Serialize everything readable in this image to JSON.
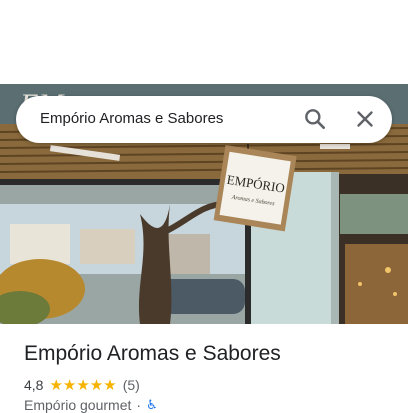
{
  "search": {
    "query": "Empório Aromas e Sabores",
    "search_icon": "search-icon",
    "close_icon": "close-icon"
  },
  "photo": {
    "sign_line1": "EMPÓRIO",
    "sign_line2": "Aromas e Sabores",
    "awning_text": "EM"
  },
  "place": {
    "name": "Empório Aromas e Sabores",
    "rating": "4,8",
    "stars": "★★★★★",
    "review_count": "(5)",
    "category": "Empório gourmet",
    "separator": "·",
    "accessibility_icon": "wheelchair-icon"
  },
  "colors": {
    "star": "#f6b400",
    "accessibility": "#1a73e8"
  }
}
